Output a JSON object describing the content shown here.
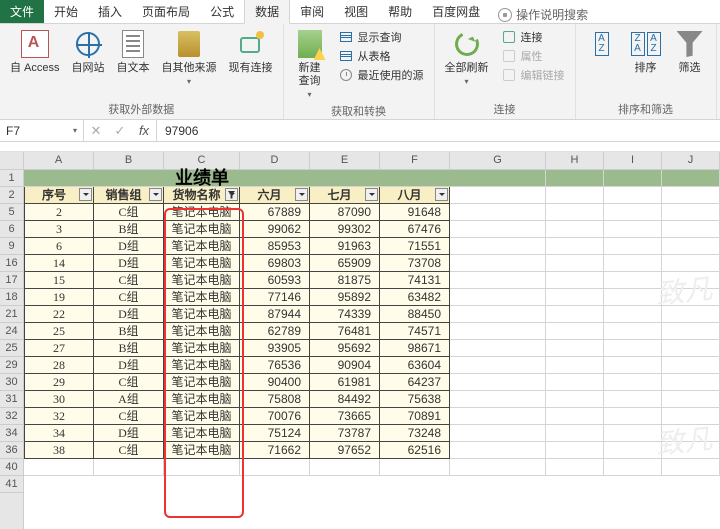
{
  "tabs": {
    "file": "文件",
    "home": "开始",
    "insert": "插入",
    "layout": "页面布局",
    "formula": "公式",
    "data": "数据",
    "review": "审阅",
    "view": "视图",
    "help": "帮助",
    "baidu": "百度网盘",
    "tell": "操作说明搜索"
  },
  "ribbon": {
    "ext": {
      "access": "自 Access",
      "web": "自网站",
      "text": "自文本",
      "other": "自其他来源",
      "conn": "现有连接",
      "label": "获取外部数据"
    },
    "get": {
      "newq": "新建\n查询",
      "show": "显示查询",
      "table": "从表格",
      "recent": "最近使用的源",
      "label": "获取和转换"
    },
    "conn": {
      "refresh": "全部刷新",
      "c1": "连接",
      "c2": "属性",
      "c3": "编辑链接",
      "label": "连接"
    },
    "sort": {
      "sort": "排序",
      "filter": "筛选",
      "label": "排序和筛选"
    }
  },
  "fbar": {
    "name": "F7",
    "value": "97906",
    "fx": "fx"
  },
  "cols": [
    "A",
    "B",
    "C",
    "D",
    "E",
    "F",
    "G",
    "H",
    "I",
    "J"
  ],
  "rownums": [
    "1",
    "2",
    "5",
    "6",
    "9",
    "16",
    "17",
    "18",
    "21",
    "24",
    "25",
    "29",
    "30",
    "31",
    "32",
    "34",
    "36",
    "40",
    "41"
  ],
  "title": "业绩单",
  "headers": [
    "序号",
    "销售组",
    "货物名称",
    "六月",
    "七月",
    "八月"
  ],
  "rows": [
    [
      "2",
      "C组",
      "笔记本电脑",
      "67889",
      "87090",
      "91648"
    ],
    [
      "3",
      "B组",
      "笔记本电脑",
      "99062",
      "99302",
      "67476"
    ],
    [
      "6",
      "D组",
      "笔记本电脑",
      "85953",
      "91963",
      "71551"
    ],
    [
      "14",
      "D组",
      "笔记本电脑",
      "69803",
      "65909",
      "73708"
    ],
    [
      "15",
      "C组",
      "笔记本电脑",
      "60593",
      "81875",
      "74131"
    ],
    [
      "19",
      "C组",
      "笔记本电脑",
      "77146",
      "95892",
      "63482"
    ],
    [
      "22",
      "D组",
      "笔记本电脑",
      "87944",
      "74339",
      "88450"
    ],
    [
      "25",
      "B组",
      "笔记本电脑",
      "62789",
      "76481",
      "74571"
    ],
    [
      "27",
      "B组",
      "笔记本电脑",
      "93905",
      "95692",
      "98671"
    ],
    [
      "28",
      "D组",
      "笔记本电脑",
      "76536",
      "90904",
      "63604"
    ],
    [
      "29",
      "C组",
      "笔记本电脑",
      "90400",
      "61981",
      "64237"
    ],
    [
      "30",
      "A组",
      "笔记本电脑",
      "75808",
      "84492",
      "75638"
    ],
    [
      "32",
      "C组",
      "笔记本电脑",
      "70076",
      "73665",
      "70891"
    ],
    [
      "34",
      "D组",
      "笔记本电脑",
      "75124",
      "73787",
      "73248"
    ],
    [
      "38",
      "C组",
      "笔记本电脑",
      "71662",
      "97652",
      "62516"
    ]
  ],
  "watermark": "致凡"
}
